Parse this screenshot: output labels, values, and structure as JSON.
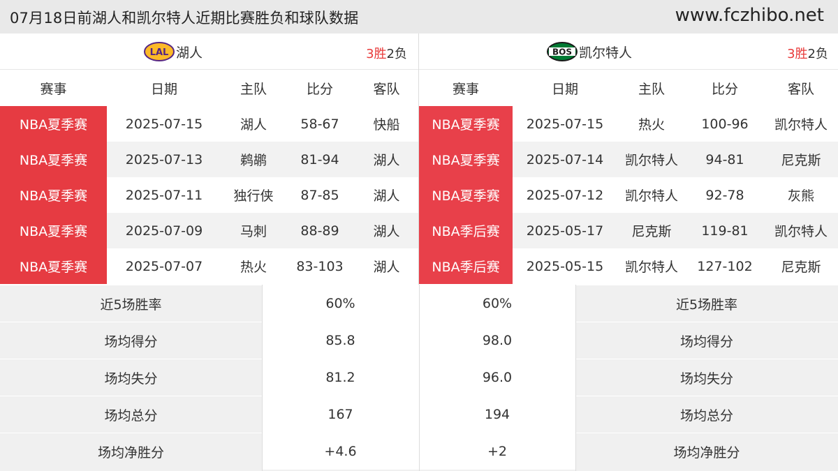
{
  "header": {
    "title": "07月18日前湖人和凯尔特人近期比赛胜负和球队数据",
    "site": "www.fczhibo.net"
  },
  "left_team": {
    "logo_text": "LAL",
    "name": "湖人",
    "record_wins": "3胜",
    "record_losses": "2负",
    "columns": [
      "赛事",
      "日期",
      "主队",
      "比分",
      "客队"
    ],
    "games": [
      {
        "event": "NBA夏季赛",
        "date": "2025-07-15",
        "home": "湖人",
        "score": "58-67",
        "away": "快船"
      },
      {
        "event": "NBA夏季赛",
        "date": "2025-07-13",
        "home": "鹈鹕",
        "score": "81-94",
        "away": "湖人"
      },
      {
        "event": "NBA夏季赛",
        "date": "2025-07-11",
        "home": "独行侠",
        "score": "87-85",
        "away": "湖人"
      },
      {
        "event": "NBA夏季赛",
        "date": "2025-07-09",
        "home": "马刺",
        "score": "88-89",
        "away": "湖人"
      },
      {
        "event": "NBA夏季赛",
        "date": "2025-07-07",
        "home": "热火",
        "score": "83-103",
        "away": "湖人"
      }
    ]
  },
  "right_team": {
    "logo_text": "BOS",
    "name": "凯尔特人",
    "record_wins": "3胜",
    "record_losses": "2负",
    "columns": [
      "赛事",
      "日期",
      "主队",
      "比分",
      "客队"
    ],
    "games": [
      {
        "event": "NBA夏季赛",
        "date": "2025-07-15",
        "home": "热火",
        "score": "100-96",
        "away": "凯尔特人"
      },
      {
        "event": "NBA夏季赛",
        "date": "2025-07-14",
        "home": "凯尔特人",
        "score": "94-81",
        "away": "尼克斯"
      },
      {
        "event": "NBA夏季赛",
        "date": "2025-07-12",
        "home": "凯尔特人",
        "score": "92-78",
        "away": "灰熊"
      },
      {
        "event": "NBA季后赛",
        "date": "2025-05-17",
        "home": "尼克斯",
        "score": "119-81",
        "away": "凯尔特人"
      },
      {
        "event": "NBA季后赛",
        "date": "2025-05-15",
        "home": "凯尔特人",
        "score": "127-102",
        "away": "尼克斯"
      }
    ]
  },
  "stats": [
    {
      "label": "近5场胜率",
      "left": "60%",
      "right": "60%"
    },
    {
      "label": "场均得分",
      "left": "85.8",
      "right": "98.0"
    },
    {
      "label": "场均失分",
      "left": "81.2",
      "right": "96.0"
    },
    {
      "label": "场均总分",
      "left": "167",
      "right": "194"
    },
    {
      "label": "场均净胜分",
      "left": "+4.6",
      "right": "+2"
    }
  ],
  "colors": {
    "event_red": "#e63b42",
    "record_red": "#e83a3a",
    "lakers_purple": "#552583",
    "lakers_gold": "#fdb927",
    "celtics_green": "#007a33"
  }
}
